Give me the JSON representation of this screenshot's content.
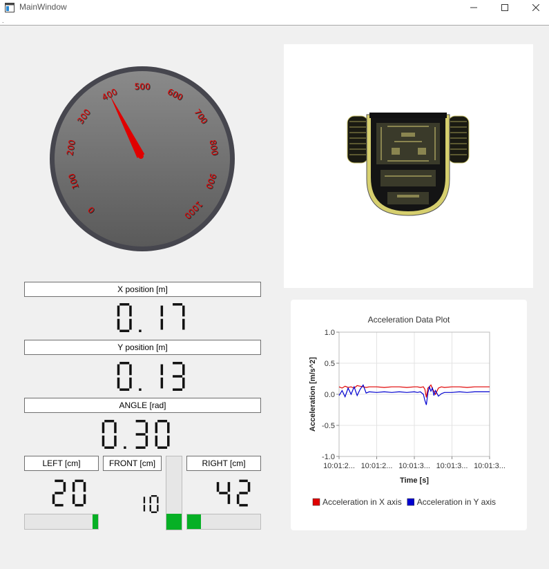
{
  "window": {
    "title": "MainWindow",
    "menu_marker": "."
  },
  "gauge": {
    "value": 400,
    "min": 0,
    "max": 1000,
    "ticks": [
      "0",
      "100",
      "200",
      "300",
      "400",
      "500",
      "600",
      "700",
      "800",
      "900",
      "1000"
    ],
    "tick_color": "#e00000",
    "needle_color": "#e00000",
    "rim_color": "#46464e"
  },
  "robot_view": {
    "description_icon": "robot-top-view-icon",
    "body_color": "#d6cf6e"
  },
  "readouts": {
    "x_label": "X position [m]",
    "x_value": "0.17",
    "y_label": "Y position [m]",
    "y_value": "0.13",
    "angle_label": "ANGLE [rad]",
    "angle_value": "0.30",
    "left_label": "LEFT [cm]",
    "left_value": "20",
    "front_label": "FRONT [cm]",
    "front_value": "10",
    "right_label": "RIGHT [cm]",
    "right_value": "42"
  },
  "bars": {
    "left_level": 0.08,
    "front_level": 0.22,
    "right_level": 0.19,
    "fill_color": "#06b025"
  },
  "chart_data": {
    "type": "line",
    "title": "Acceleration Data Plot",
    "xlabel": "Time [s]",
    "ylabel": "Acceleration [m/s^2]",
    "ylim": [
      -1.0,
      1.0
    ],
    "yticks": [
      "1.0",
      "0.5",
      "0.0",
      "-0.5",
      "-1.0"
    ],
    "xticks": [
      "10:01:2...",
      "10:01:2...",
      "10:01:3...",
      "10:01:3...",
      "10:01:3..."
    ],
    "grid": true,
    "legend_placement": "bottom",
    "x": [
      0,
      0.02,
      0.04,
      0.06,
      0.08,
      0.1,
      0.12,
      0.14,
      0.16,
      0.18,
      0.2,
      0.25,
      0.3,
      0.35,
      0.4,
      0.45,
      0.5,
      0.52,
      0.54,
      0.56,
      0.57,
      0.58,
      0.59,
      0.6,
      0.61,
      0.62,
      0.63,
      0.64,
      0.66,
      0.68,
      0.7,
      0.75,
      0.8,
      0.85,
      0.9,
      0.95,
      1.0
    ],
    "series": [
      {
        "name": "Acceleration in X axis",
        "color": "#e00000",
        "values": [
          0.12,
          0.1,
          0.13,
          0.11,
          0.12,
          0.1,
          0.14,
          0.13,
          0.12,
          0.11,
          0.12,
          0.12,
          0.11,
          0.12,
          0.12,
          0.11,
          0.12,
          0.12,
          0.11,
          0.12,
          0.08,
          -0.05,
          0.1,
          0.12,
          0.15,
          0.09,
          0.05,
          0.0,
          0.1,
          0.12,
          0.11,
          0.12,
          0.12,
          0.11,
          0.12,
          0.12,
          0.12
        ]
      },
      {
        "name": "Acceleration in Y axis",
        "color": "#0000d0",
        "values": [
          -0.02,
          0.06,
          -0.04,
          0.1,
          0.0,
          0.12,
          -0.02,
          0.08,
          0.15,
          0.02,
          0.04,
          0.03,
          0.04,
          0.03,
          0.04,
          0.03,
          0.04,
          0.03,
          0.04,
          0.0,
          -0.1,
          -0.17,
          0.02,
          0.12,
          0.05,
          0.1,
          -0.02,
          0.06,
          -0.03,
          0.01,
          0.03,
          0.03,
          0.04,
          0.03,
          0.04,
          0.04,
          0.04
        ]
      }
    ]
  }
}
